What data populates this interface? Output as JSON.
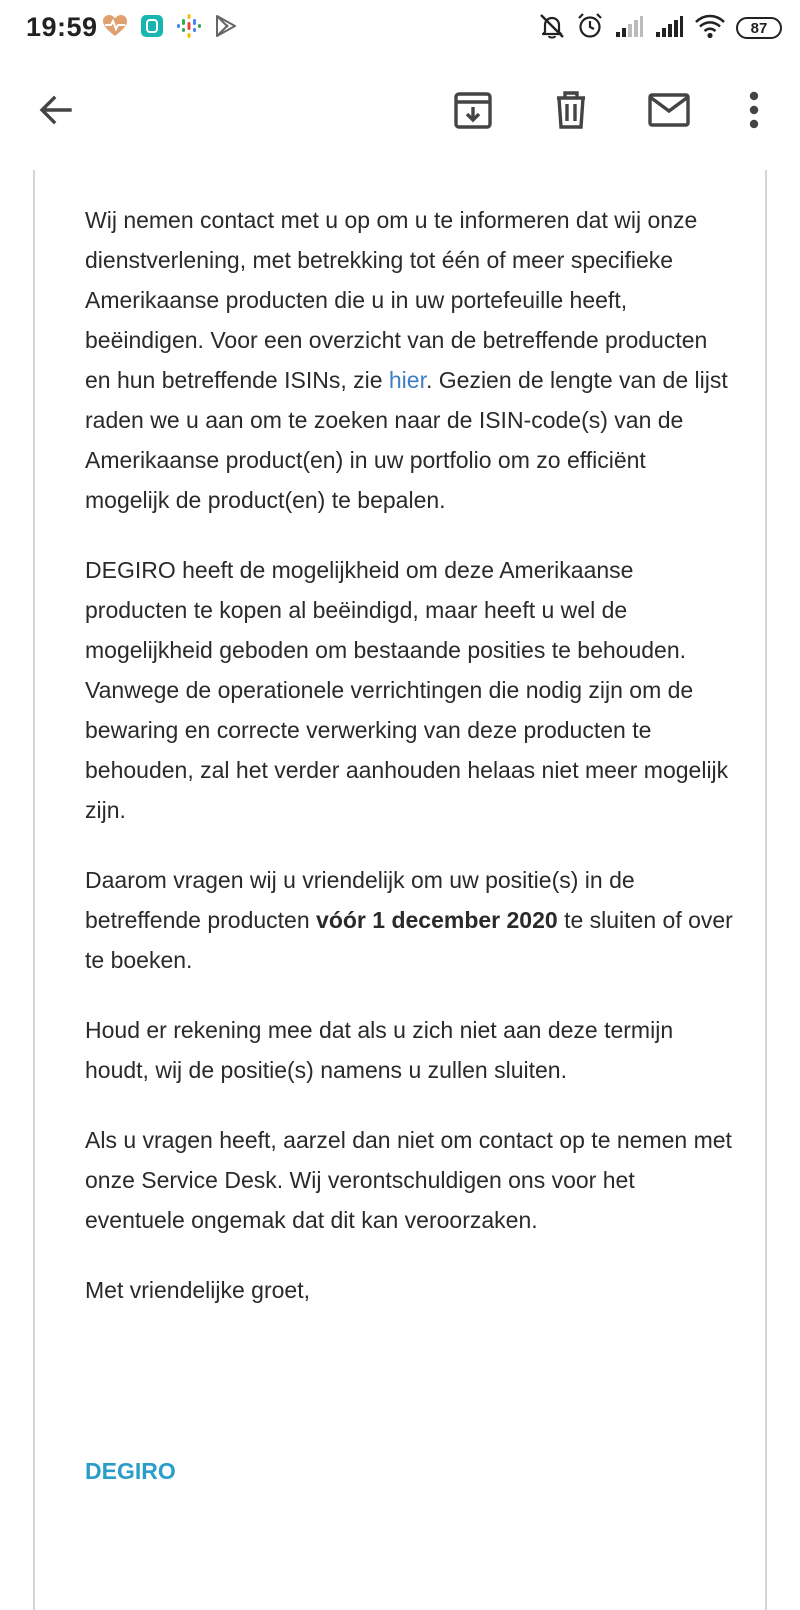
{
  "status_bar": {
    "time": "19:59",
    "battery": "87"
  },
  "toolbar": {
    "back_icon": "arrow-left-icon",
    "archive_icon": "archive-icon",
    "delete_icon": "trash-icon",
    "mail_icon": "mail-icon",
    "more_icon": "more-vert-icon"
  },
  "email": {
    "p1_a": "Wij nemen contact met u op om u te informeren dat wij onze dienstverlening, met betrekking tot één of meer specifieke Amerikaanse producten die u in uw portefeuille heeft, beëindigen. Voor een overzicht van de betreffende producten en hun betreffende ISINs, zie ",
    "p1_link": "hier",
    "p1_b": ". Gezien de lengte van de lijst raden we u aan om te zoeken naar de ISIN-code(s) van de Amerikaanse product(en) in uw portfolio om zo efficiënt mogelijk de product(en) te bepalen.",
    "p2": "DEGIRO heeft de mogelijkheid om deze Amerikaanse producten te kopen al beëindigd, maar heeft u wel de mogelijkheid geboden om bestaande posities te behouden. Vanwege de operationele verrichtingen die nodig zijn om de bewaring en correcte verwerking van deze producten te behouden, zal het verder aanhouden helaas niet meer mogelijk zijn.",
    "p3_a": "Daarom vragen wij u vriendelijk om uw positie(s) in de betreffende producten ",
    "p3_bold": "vóór 1 december 2020",
    "p3_b": " te sluiten of over te boeken.",
    "p4": "Houd er rekening mee dat als u zich niet aan deze termijn houdt, wij de positie(s) namens u zullen sluiten.",
    "p5": "Als u vragen heeft, aarzel dan niet om contact op te nemen met onze Service Desk. Wij verontschuldigen ons voor het eventuele ongemak dat dit kan veroorzaken.",
    "p6": "Met vriendelijke groet,",
    "signature": "DEGIRO"
  },
  "colors": {
    "link": "#3d7fc4",
    "signature": "#2a9ec9"
  }
}
